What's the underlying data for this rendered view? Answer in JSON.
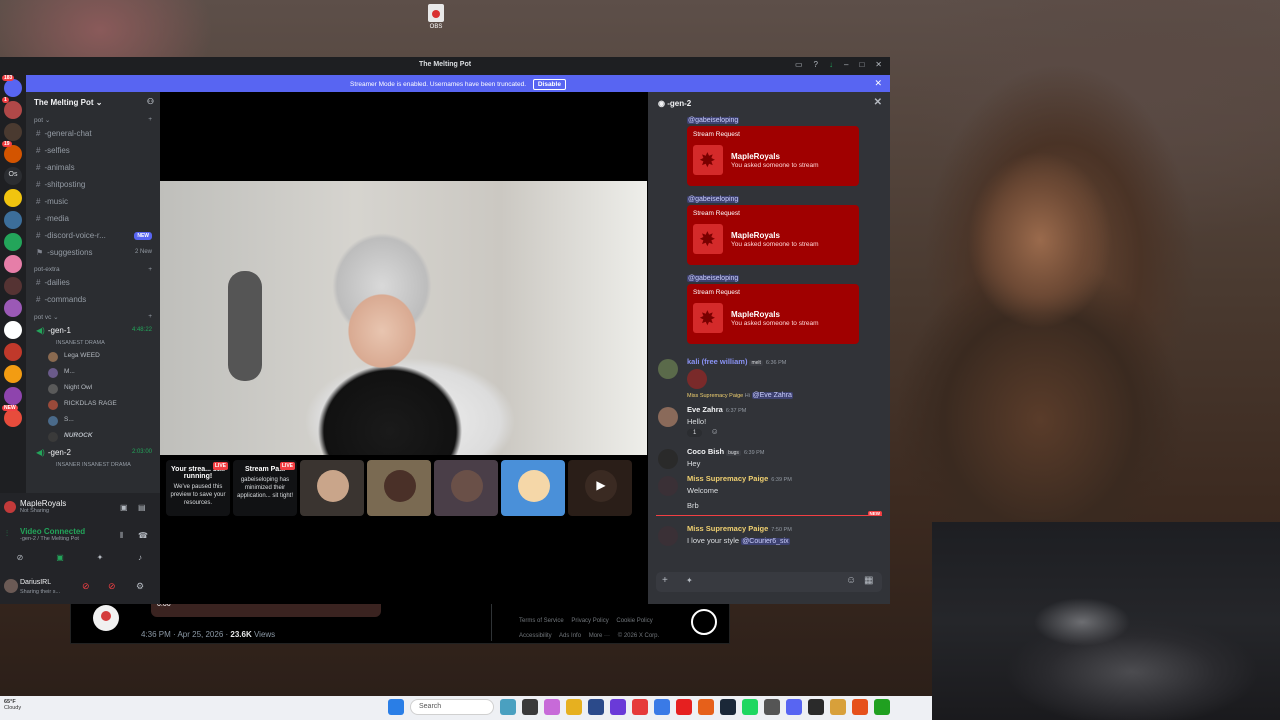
{
  "desktop": {
    "icon_label": "OBS"
  },
  "window": {
    "title": "The Melting Pot",
    "banner_text": "Streamer Mode is enabled. Usernames have been truncated.",
    "banner_button": "Disable"
  },
  "rail": {
    "badge_1": "183",
    "badge_2": "1",
    "badge_3": "19",
    "badge_4": "Os",
    "badge_new": "NEW"
  },
  "server": {
    "name": "The Melting Pot",
    "categories": {
      "pot": "pot",
      "pot_extra": "pot-extra",
      "pot_vc": "pot vc"
    },
    "channels": [
      {
        "name": "-general-chat"
      },
      {
        "name": "-selfies"
      },
      {
        "name": "-animals"
      },
      {
        "name": "-shitposting"
      },
      {
        "name": "-music"
      },
      {
        "name": "-media"
      },
      {
        "name": "-discord-voice-r...",
        "badge": "NEW"
      },
      {
        "name": "-suggestions",
        "count": "2 New"
      }
    ],
    "extra_channels": [
      {
        "name": "-dailies"
      },
      {
        "name": "-commands"
      }
    ],
    "voice": {
      "gen1": {
        "name": "-gen-1",
        "timer": "4:48:22",
        "sub": "INSANEST DRAMA"
      },
      "gen1_users": [
        "Lega WEED",
        "M...",
        "Night Owl",
        "RICKDLAS RAGE",
        "S..."
      ],
      "gen1_bold_user": "NUROCK",
      "gen2": {
        "name": "-gen-2",
        "timer": "2:03:00",
        "sub": "INSANER INSANEST DRAMA"
      }
    }
  },
  "voice_panel": {
    "user": "MapleRoyals",
    "user_status": "Not Sharing",
    "connected": "Video Connected",
    "channel": "-gen-2 / The Melting Pot",
    "me_name": "DariusIRL",
    "me_status": "Sharing their s..."
  },
  "stream_tiles": [
    {
      "title": "Your strea... still running!",
      "body": "We've paused this preview to save your resources.",
      "live": "LIVE"
    },
    {
      "title": "Stream Pa...",
      "body": "gabeiseloping has minimized their application... sit tight!",
      "live": "LIVE"
    }
  ],
  "chat": {
    "channel": "-gen-2",
    "mention": "@gabeiseloping",
    "card": {
      "title": "Stream Request",
      "name": "MapleRoyals",
      "sub": "You asked someone to stream"
    },
    "messages": {
      "kali": {
        "name": "kali (free william)",
        "tag": "melt",
        "time": "6:36 PM"
      },
      "eve": {
        "reply_name": "Miss Supremacy Paige",
        "reply_text": "Hi",
        "reply_mention": "@Eve Zahra",
        "name": "Eve Zahra",
        "time": "6:37 PM",
        "text": "Hello!",
        "reaction": "1"
      },
      "coco": {
        "name": "Coco Bish",
        "tag": "bugs",
        "time": "6:39 PM",
        "text": "Hey"
      },
      "paige1": {
        "name": "Miss Supremacy Paige",
        "time": "6:39 PM",
        "text1": "Welcome",
        "text2": "Brb"
      },
      "paige2": {
        "name": "Miss Supremacy Paige",
        "time": "7:50 PM",
        "text": "I love your style",
        "mention": "@Courier6_six"
      }
    },
    "new_label": "NEW"
  },
  "xpost": {
    "video_time": "0:06",
    "time": "4:36 PM · Apr 25, 2026 · ",
    "views": "23.6K",
    "views_label": " Views",
    "footer": [
      "Terms of Service",
      "Privacy Policy",
      "Cookie Policy",
      "Accessibility",
      "Ads Info",
      "More ···",
      "© 2026 X Corp."
    ]
  },
  "taskbar": {
    "temp": "65°F",
    "weather": "Cloudy",
    "search": "Search"
  },
  "colors": {
    "blurple": "#5865f2",
    "green": "#23a55a",
    "red_card": "#a00000"
  }
}
